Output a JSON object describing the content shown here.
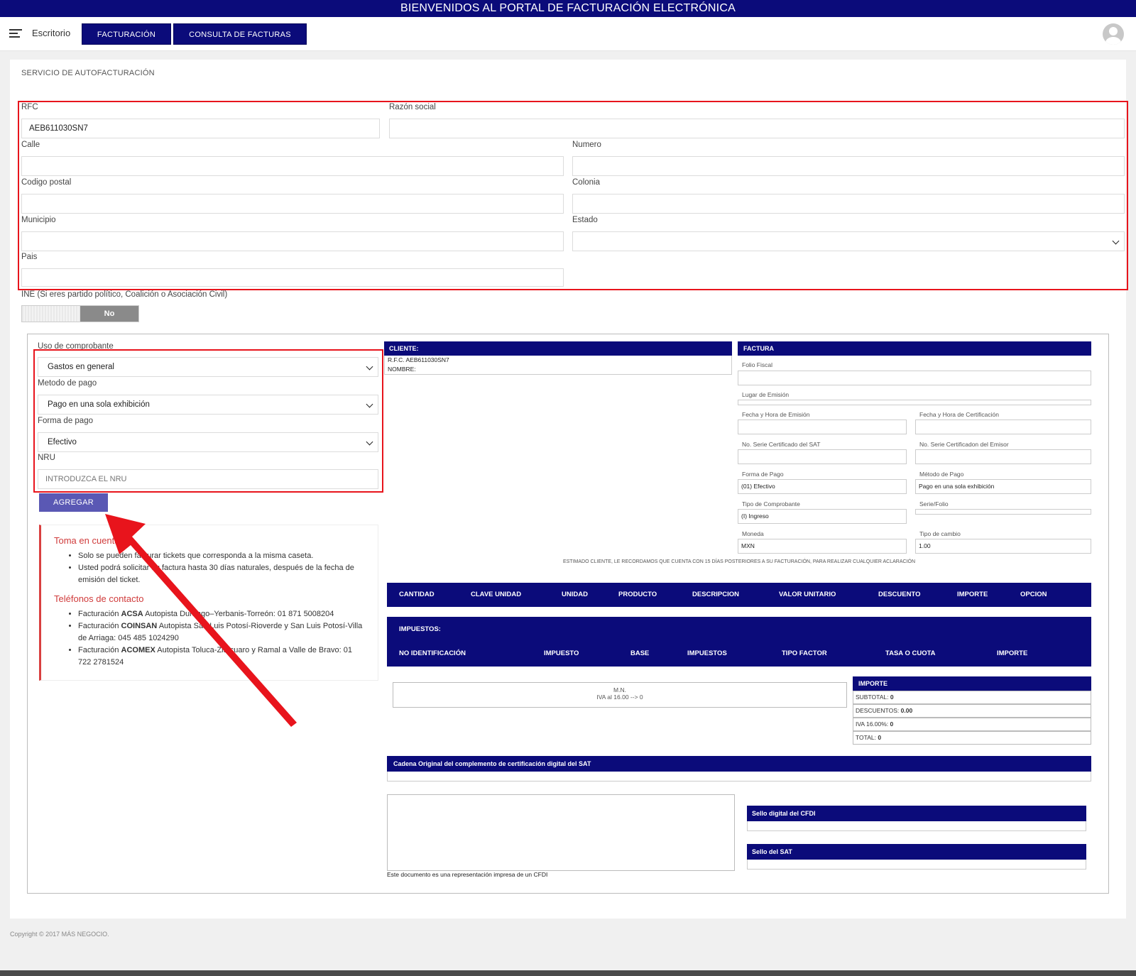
{
  "header": {
    "banner": "BIENVENIDOS AL PORTAL DE FACTURACIÓN ELECTRÓNICA"
  },
  "nav": {
    "desk": "Escritorio",
    "tabs": [
      "FACTURACIÓN",
      "CONSULTA DE FACTURAS"
    ]
  },
  "section": {
    "title": "SERVICIO DE AUTOFACTURACIÓN"
  },
  "fiscal_form": {
    "rfc_label": "RFC",
    "rfc_value": "AEB611030SN7",
    "razon_label": "Razón social",
    "calle_label": "Calle",
    "numero_label": "Numero",
    "cp_label": "Codigo postal",
    "colonia_label": "Colonia",
    "municipio_label": "Municipio",
    "estado_label": "Estado",
    "pais_label": "Pais",
    "ine_label": "INE (Si eres partido político, Coalición o Asociación Civil)",
    "ine_toggle": "No"
  },
  "comprobante": {
    "uso_label": "Uso de comprobante",
    "uso_value": "Gastos en general",
    "metodo_label": "Metodo de pago",
    "metodo_value": "Pago en una sola exhibición",
    "forma_label": "Forma de pago",
    "forma_value": "Efectivo",
    "nru_label": "NRU",
    "nru_placeholder": "INTRODUZCA EL NRU",
    "agregar": "AGREGAR"
  },
  "notice": {
    "title": "Toma en cuenta",
    "items": [
      "Solo se pueden facturar tickets que corresponda a la misma caseta.",
      "Usted podrá solicitar su factura hasta 30 días naturales, después de la fecha de emisión del ticket."
    ],
    "contacts_title": "Teléfonos de contacto",
    "contacts": [
      {
        "pre": "Facturación ",
        "bold": "ACSA",
        "post": " Autopista Durango–Yerbanis-Torreón: 01 871 5008204"
      },
      {
        "pre": "Facturación ",
        "bold": "COINSAN",
        "post": " Autopista San Luis Potosí-Rioverde y San Luis Potosí-Villa de Arriaga: 045 485 1024290"
      },
      {
        "pre": "Facturación ",
        "bold": "ACOMEX",
        "post": " Autopista Toluca-Zitácuaro y Ramal a Valle de Bravo: 01 722 2781524"
      }
    ]
  },
  "cliente": {
    "head": "CLIENTE:",
    "rfc_line": "R.F.C. AEB611030SN7",
    "nombre_line": "NOMBRE:"
  },
  "factura": {
    "head": "FACTURA",
    "folio_label": "Folio Fiscal",
    "lugar_label": "Lugar de Emisión",
    "fecha_emision_label": "Fecha y Hora de Emisión",
    "fecha_cert_label": "Fecha y Hora de Certificación",
    "serie_sat_label": "No. Serie Certificado del SAT",
    "serie_emisor_label": "No. Serie Certificadon del Emisor",
    "forma_pago_label": "Forma de Pago",
    "forma_pago_value": "(01) Efectivo",
    "metodo_pago_label": "Método de Pago",
    "metodo_pago_value": "Pago en una sola exhibición",
    "tipo_comp_label": "Tipo de Comprobante",
    "tipo_comp_value": "(I) Ingreso",
    "serie_folio_label": "Serie/Folio",
    "moneda_label": "Moneda",
    "moneda_value": "MXN",
    "tipo_cambio_label": "Tipo de cambio",
    "tipo_cambio_value": "1.00",
    "notice": "ESTIMADO CLIENTE, LE RECORDAMOS QUE CUENTA CON 15 DÍAS POSTERIORES A SU FACTURACIÓN, PARA REALIZAR CUALQUIER ACLARACIÓN"
  },
  "items_table": {
    "columns": [
      "CANTIDAD",
      "CLAVE UNIDAD",
      "UNIDAD",
      "PRODUCTO",
      "DESCRIPCION",
      "VALOR UNITARIO",
      "DESCUENTO",
      "IMPORTE",
      "OPCION"
    ]
  },
  "taxes_table": {
    "title": "IMPUESTOS:",
    "columns": [
      "NO IDENTIFICACIÓN",
      "IMPUESTO",
      "BASE",
      "IMPUESTOS",
      "TIPO FACTOR",
      "TASA O CUOTA",
      "IMPORTE"
    ]
  },
  "totals": {
    "mn": "M.N.",
    "iva_line": "IVA al 16.00 --> 0",
    "head": "IMPORTE",
    "rows": [
      {
        "label": "SUBTOTAL:",
        "value": "0"
      },
      {
        "label": "DESCUENTOS:",
        "value": "0.00"
      },
      {
        "label": "IVA 16.00%:",
        "value": "0"
      },
      {
        "label": "TOTAL:",
        "value": "0"
      }
    ]
  },
  "cadena": {
    "head": "Cadena Original del complemento de certificación digital del SAT"
  },
  "sellos": {
    "cfdi_head": "Sello digital del CFDI",
    "sat_head": "Sello del SAT",
    "representation_note": "Este documento es una representación impresa de un CFDI"
  },
  "footer": {
    "copyright": "Copyright © 2017 MÁS NEGOCIO."
  },
  "colors": {
    "brand": "#0b0b7a",
    "accent_button": "#5a58b4",
    "highlight": "#e8141c",
    "notice_title": "#d03b3b"
  }
}
